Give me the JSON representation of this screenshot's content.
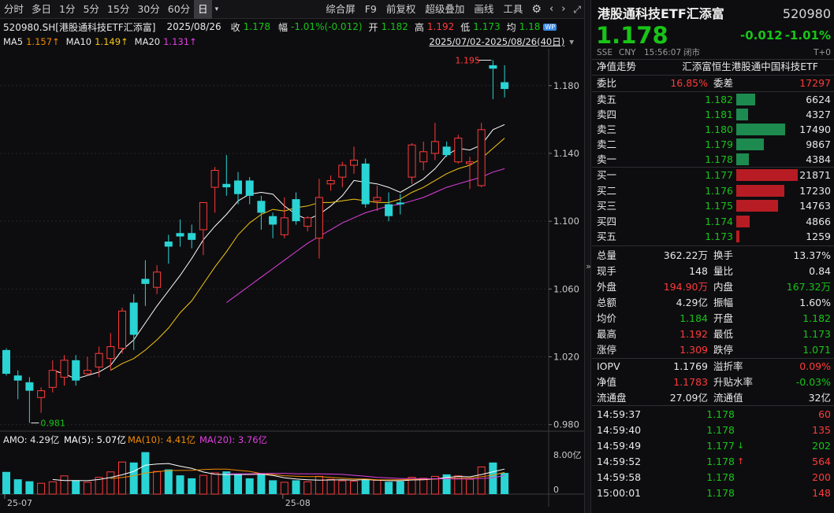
{
  "toolbar": {
    "left": [
      "分时",
      "多日",
      "1分",
      "5分",
      "15分",
      "30分",
      "60分",
      "日"
    ],
    "active": "日",
    "dropdown_icon": "chevron-down-icon",
    "right": [
      "综合屏",
      "F9",
      "前复权",
      "超级叠加",
      "画线",
      "工具"
    ]
  },
  "infobar": {
    "code_name": "520980.SH[港股通科技ETF汇添富]",
    "date": "2025/08/26",
    "close_label": "收",
    "close": "1.178",
    "change_label": "幅",
    "change": "-1.01%(-0.012)",
    "open_label": "开",
    "open": "1.182",
    "high_label": "高",
    "high": "1.192",
    "low_label": "低",
    "low": "1.173",
    "avg_label": "均",
    "avg": "1.18"
  },
  "mabar": {
    "ma5_label": "MA5",
    "ma5": "1.157↑",
    "ma10_label": "MA10",
    "ma10": "1.149↑",
    "ma20_label": "MA20",
    "ma20": "1.131↑",
    "range": "2025/07/02-2025/08/26(40日)"
  },
  "chart_data": {
    "type": "candlestick",
    "y_ticks": [
      "1.180",
      "1.140",
      "1.100",
      "1.060",
      "1.020",
      "0.980"
    ],
    "ylim": [
      0.978,
      1.198
    ],
    "x_ticks": [
      "25-07",
      "25-08"
    ],
    "annotations": {
      "max": "1.195",
      "min": "0.981"
    },
    "candles": [
      [
        1.024,
        1.025,
        1.009,
        1.01
      ],
      [
        1.009,
        1.012,
        0.995,
        1.006
      ],
      [
        1.005,
        1.008,
        0.981,
        1.0
      ],
      [
        0.996,
        1.002,
        0.987,
        1.0
      ],
      [
        1.002,
        1.018,
        0.999,
        1.012
      ],
      [
        1.008,
        1.021,
        1.003,
        1.018
      ],
      [
        1.018,
        1.021,
        1.003,
        1.006
      ],
      [
        1.01,
        1.02,
        1.009,
        1.012
      ],
      [
        1.014,
        1.026,
        1.008,
        1.022
      ],
      [
        1.019,
        1.034,
        1.012,
        1.026
      ],
      [
        1.025,
        1.049,
        1.022,
        1.047
      ],
      [
        1.052,
        1.057,
        1.024,
        1.033
      ],
      [
        1.066,
        1.077,
        1.05,
        1.063
      ],
      [
        1.061,
        1.074,
        1.057,
        1.07
      ],
      [
        1.088,
        1.092,
        1.075,
        1.085
      ],
      [
        1.093,
        1.101,
        1.085,
        1.091
      ],
      [
        1.093,
        1.098,
        1.084,
        1.089
      ],
      [
        1.095,
        1.111,
        1.08,
        1.111
      ],
      [
        1.12,
        1.132,
        1.105,
        1.13
      ],
      [
        1.122,
        1.139,
        1.115,
        1.12
      ],
      [
        1.124,
        1.129,
        1.11,
        1.116
      ],
      [
        1.124,
        1.126,
        1.11,
        1.115
      ],
      [
        1.112,
        1.115,
        1.095,
        1.105
      ],
      [
        1.103,
        1.105,
        1.09,
        1.098
      ],
      [
        1.092,
        1.114,
        1.09,
        1.102
      ],
      [
        1.113,
        1.117,
        1.098,
        1.1
      ],
      [
        1.097,
        1.103,
        1.094,
        1.102
      ],
      [
        1.09,
        1.125,
        1.078,
        1.114
      ],
      [
        1.122,
        1.127,
        1.118,
        1.124
      ],
      [
        1.126,
        1.135,
        1.12,
        1.133
      ],
      [
        1.133,
        1.144,
        1.128,
        1.136
      ],
      [
        1.134,
        1.137,
        1.108,
        1.11
      ],
      [
        1.112,
        1.121,
        1.106,
        1.114
      ],
      [
        1.11,
        1.117,
        1.1,
        1.103
      ],
      [
        1.111,
        1.116,
        1.104,
        1.11
      ],
      [
        1.126,
        1.146,
        1.122,
        1.145
      ],
      [
        1.135,
        1.147,
        1.13,
        1.141
      ],
      [
        1.14,
        1.158,
        1.136,
        1.147
      ],
      [
        1.144,
        1.147,
        1.138,
        1.139
      ],
      [
        1.135,
        1.151,
        1.134,
        1.149
      ],
      [
        1.134,
        1.138,
        1.119,
        1.135
      ],
      [
        1.121,
        1.158,
        1.12,
        1.154
      ],
      [
        1.192,
        1.195,
        1.172,
        1.19
      ],
      [
        1.182,
        1.192,
        1.173,
        1.178
      ]
    ],
    "ma5": [
      null,
      null,
      null,
      null,
      1.012,
      1.01,
      1.007,
      1.009,
      1.011,
      1.015,
      1.024,
      1.03,
      1.04,
      1.05,
      1.059,
      1.068,
      1.078,
      1.089,
      1.097,
      1.104,
      1.112,
      1.116,
      1.117,
      1.116,
      1.109,
      1.104,
      1.101,
      1.104,
      1.109,
      1.115,
      1.124,
      1.123,
      1.122,
      1.12,
      1.117,
      1.121,
      1.125,
      1.131,
      1.139,
      1.143,
      1.142,
      1.145,
      1.154,
      1.157
    ],
    "ma10": [
      null,
      null,
      null,
      null,
      null,
      null,
      null,
      null,
      null,
      1.012,
      1.016,
      1.019,
      1.024,
      1.03,
      1.037,
      1.046,
      1.053,
      1.063,
      1.073,
      1.082,
      1.092,
      1.099,
      1.104,
      1.107,
      1.106,
      1.108,
      1.109,
      1.111,
      1.111,
      1.112,
      1.113,
      1.112,
      1.111,
      1.111,
      1.113,
      1.117,
      1.12,
      1.124,
      1.128,
      1.131,
      1.133,
      1.137,
      1.143,
      1.149
    ],
    "ma20": [
      null,
      null,
      null,
      null,
      null,
      null,
      null,
      null,
      null,
      null,
      null,
      null,
      null,
      null,
      null,
      null,
      null,
      null,
      null,
      1.052,
      1.057,
      1.062,
      1.067,
      1.072,
      1.077,
      1.082,
      1.087,
      1.091,
      1.095,
      1.099,
      1.102,
      1.105,
      1.107,
      1.109,
      1.11,
      1.112,
      1.114,
      1.117,
      1.12,
      1.122,
      1.124,
      1.126,
      1.129,
      1.131
    ],
    "volume": {
      "label": "AMO: 4.29亿",
      "ma5_label": "MA(5): 5.07亿",
      "ma10_label": "MA(10): 4.41亿",
      "ma20_label": "MA(20): 3.76亿",
      "y_ticks": [
        "8.00亿",
        "0"
      ],
      "values": [
        4.5,
        3.0,
        2.6,
        2.2,
        2.5,
        3.7,
        2.8,
        2.4,
        3.4,
        4.5,
        6.5,
        6.4,
        8.5,
        4.6,
        5.0,
        3.8,
        3.2,
        3.8,
        4.3,
        4.6,
        4.0,
        3.2,
        4.1,
        2.8,
        2.4,
        2.8,
        2.5,
        3.6,
        3.0,
        2.7,
        2.6,
        3.0,
        2.8,
        2.5,
        2.6,
        3.4,
        3.2,
        3.6,
        4.0,
        3.7,
        3.0,
        5.5,
        6.4,
        4.29
      ],
      "ma5": [
        null,
        null,
        null,
        null,
        2.96,
        2.76,
        2.76,
        2.72,
        2.96,
        3.36,
        3.92,
        4.6,
        5.86,
        6.1,
        6.2,
        5.66,
        5.22,
        4.48,
        4.02,
        3.94,
        3.98,
        3.98,
        4.04,
        3.78,
        3.3,
        3.06,
        2.92,
        2.82,
        2.86,
        2.92,
        2.84,
        2.94,
        2.82,
        2.72,
        2.7,
        2.86,
        2.9,
        3.06,
        3.36,
        3.58,
        3.5,
        3.96,
        4.52,
        5.07
      ],
      "ma10": [
        null,
        null,
        null,
        null,
        null,
        null,
        null,
        null,
        null,
        3.16,
        3.36,
        3.7,
        4.29,
        4.53,
        4.78,
        4.79,
        4.83,
        4.97,
        5.06,
        5.07,
        4.82,
        4.6,
        4.16,
        3.98,
        3.72,
        3.62,
        3.55,
        3.53,
        3.4,
        3.21,
        3.07,
        3.05,
        2.92,
        2.89,
        2.91,
        2.97,
        3.04,
        3.04,
        3.14,
        3.24,
        3.27,
        3.52,
        3.84,
        4.41
      ],
      "ma20": [
        null,
        null,
        null,
        null,
        null,
        null,
        null,
        null,
        null,
        null,
        null,
        null,
        null,
        null,
        null,
        null,
        null,
        null,
        null,
        4.11,
        4.09,
        4.1,
        4.18,
        4.21,
        4.2,
        4.13,
        4.1,
        4.09,
        4.06,
        3.99,
        3.8,
        3.63,
        3.37,
        3.28,
        3.15,
        3.13,
        3.12,
        3.11,
        3.1,
        3.04,
        3.05,
        3.17,
        3.3,
        3.76
      ]
    }
  },
  "quote": {
    "name": "港股通科技ETF汇添富",
    "code": "520980",
    "price": "1.178",
    "change": "-0.012",
    "change_pct": "-1.01%",
    "market": "SSE",
    "currency": "CNY",
    "time": "15:56:07",
    "status": "闭市",
    "settle": "T+0",
    "nav_trend_label": "净值走势",
    "index_name": "汇添富恒生港股通中国科技ETF"
  },
  "orderbook": {
    "weibi_label": "委比",
    "weibi": "16.85%",
    "weicha_label": "委差",
    "weicha": "17297",
    "asks": [
      {
        "label": "卖五",
        "price": "1.182",
        "vol": "6624",
        "vol_n": 6624
      },
      {
        "label": "卖四",
        "price": "1.181",
        "vol": "4327",
        "vol_n": 4327
      },
      {
        "label": "卖三",
        "price": "1.180",
        "vol": "17490",
        "vol_n": 17490
      },
      {
        "label": "卖二",
        "price": "1.179",
        "vol": "9867",
        "vol_n": 9867
      },
      {
        "label": "卖一",
        "price": "1.178",
        "vol": "4384",
        "vol_n": 4384
      }
    ],
    "bids": [
      {
        "label": "买一",
        "price": "1.177",
        "vol": "21871",
        "vol_n": 21871
      },
      {
        "label": "买二",
        "price": "1.176",
        "vol": "17230",
        "vol_n": 17230
      },
      {
        "label": "买三",
        "price": "1.175",
        "vol": "14763",
        "vol_n": 14763
      },
      {
        "label": "买四",
        "price": "1.174",
        "vol": "4866",
        "vol_n": 4866
      },
      {
        "label": "买五",
        "price": "1.173",
        "vol": "1259",
        "vol_n": 1259
      }
    ]
  },
  "stats": [
    {
      "l1": "总量",
      "v1": "362.22万",
      "c1": "white",
      "l2": "换手",
      "v2": "13.37%",
      "c2": "white"
    },
    {
      "l1": "现手",
      "v1": "148",
      "c1": "white",
      "l2": "量比",
      "v2": "0.84",
      "c2": "white"
    },
    {
      "l1": "外盘",
      "v1": "194.90万",
      "c1": "red",
      "l2": "内盘",
      "v2": "167.32万",
      "c2": "green"
    },
    {
      "l1": "总额",
      "v1": "4.29亿",
      "c1": "white",
      "l2": "振幅",
      "v2": "1.60%",
      "c2": "white"
    },
    {
      "l1": "均价",
      "v1": "1.184",
      "c1": "green",
      "l2": "开盘",
      "v2": "1.182",
      "c2": "green"
    },
    {
      "l1": "最高",
      "v1": "1.192",
      "c1": "red",
      "l2": "最低",
      "v2": "1.173",
      "c2": "green"
    },
    {
      "l1": "涨停",
      "v1": "1.309",
      "c1": "red",
      "l2": "跌停",
      "v2": "1.071",
      "c2": "green"
    }
  ],
  "iopv": [
    {
      "l1": "IOPV",
      "v1": "1.1769",
      "c1": "white",
      "l2": "溢折率",
      "v2": "0.09%",
      "c2": "red"
    },
    {
      "l1": "净值",
      "v1": "1.1783",
      "c1": "red",
      "l2": "升贴水率",
      "v2": "-0.03%",
      "c2": "green"
    },
    {
      "l1": "流通盘",
      "v1": "27.09亿",
      "c1": "white",
      "l2": "流通值",
      "v2": "32亿",
      "c2": "white"
    }
  ],
  "ticks": [
    {
      "time": "14:59:37",
      "price": "1.178",
      "arrow": "",
      "vol": "60",
      "vc": "red"
    },
    {
      "time": "14:59:40",
      "price": "1.178",
      "arrow": "",
      "vol": "135",
      "vc": "red"
    },
    {
      "time": "14:59:49",
      "price": "1.177",
      "arrow": "↓",
      "vol": "202",
      "vc": "green"
    },
    {
      "time": "14:59:52",
      "price": "1.178",
      "arrow": "↑",
      "vol": "564",
      "vc": "red"
    },
    {
      "time": "14:59:58",
      "price": "1.178",
      "arrow": "",
      "vol": "200",
      "vc": "red"
    },
    {
      "time": "15:00:01",
      "price": "1.178",
      "arrow": "",
      "vol": "148",
      "vc": "red"
    }
  ],
  "colors": {
    "up": "#ff3a3a",
    "down": "#2ad4d4",
    "ma5": "#ffffff",
    "ma10": "#f3c613",
    "ma20": "#e040e0",
    "green": "#18c418",
    "red": "#ff3a3a",
    "bid_bar": "#b71c24",
    "ask_bar": "#1d8a4f"
  },
  "icons": {
    "settings": "gear-icon",
    "fullscreen": "expand-icon",
    "collapse": "double-chevron-right-icon",
    "nav": "chevron-icon"
  }
}
